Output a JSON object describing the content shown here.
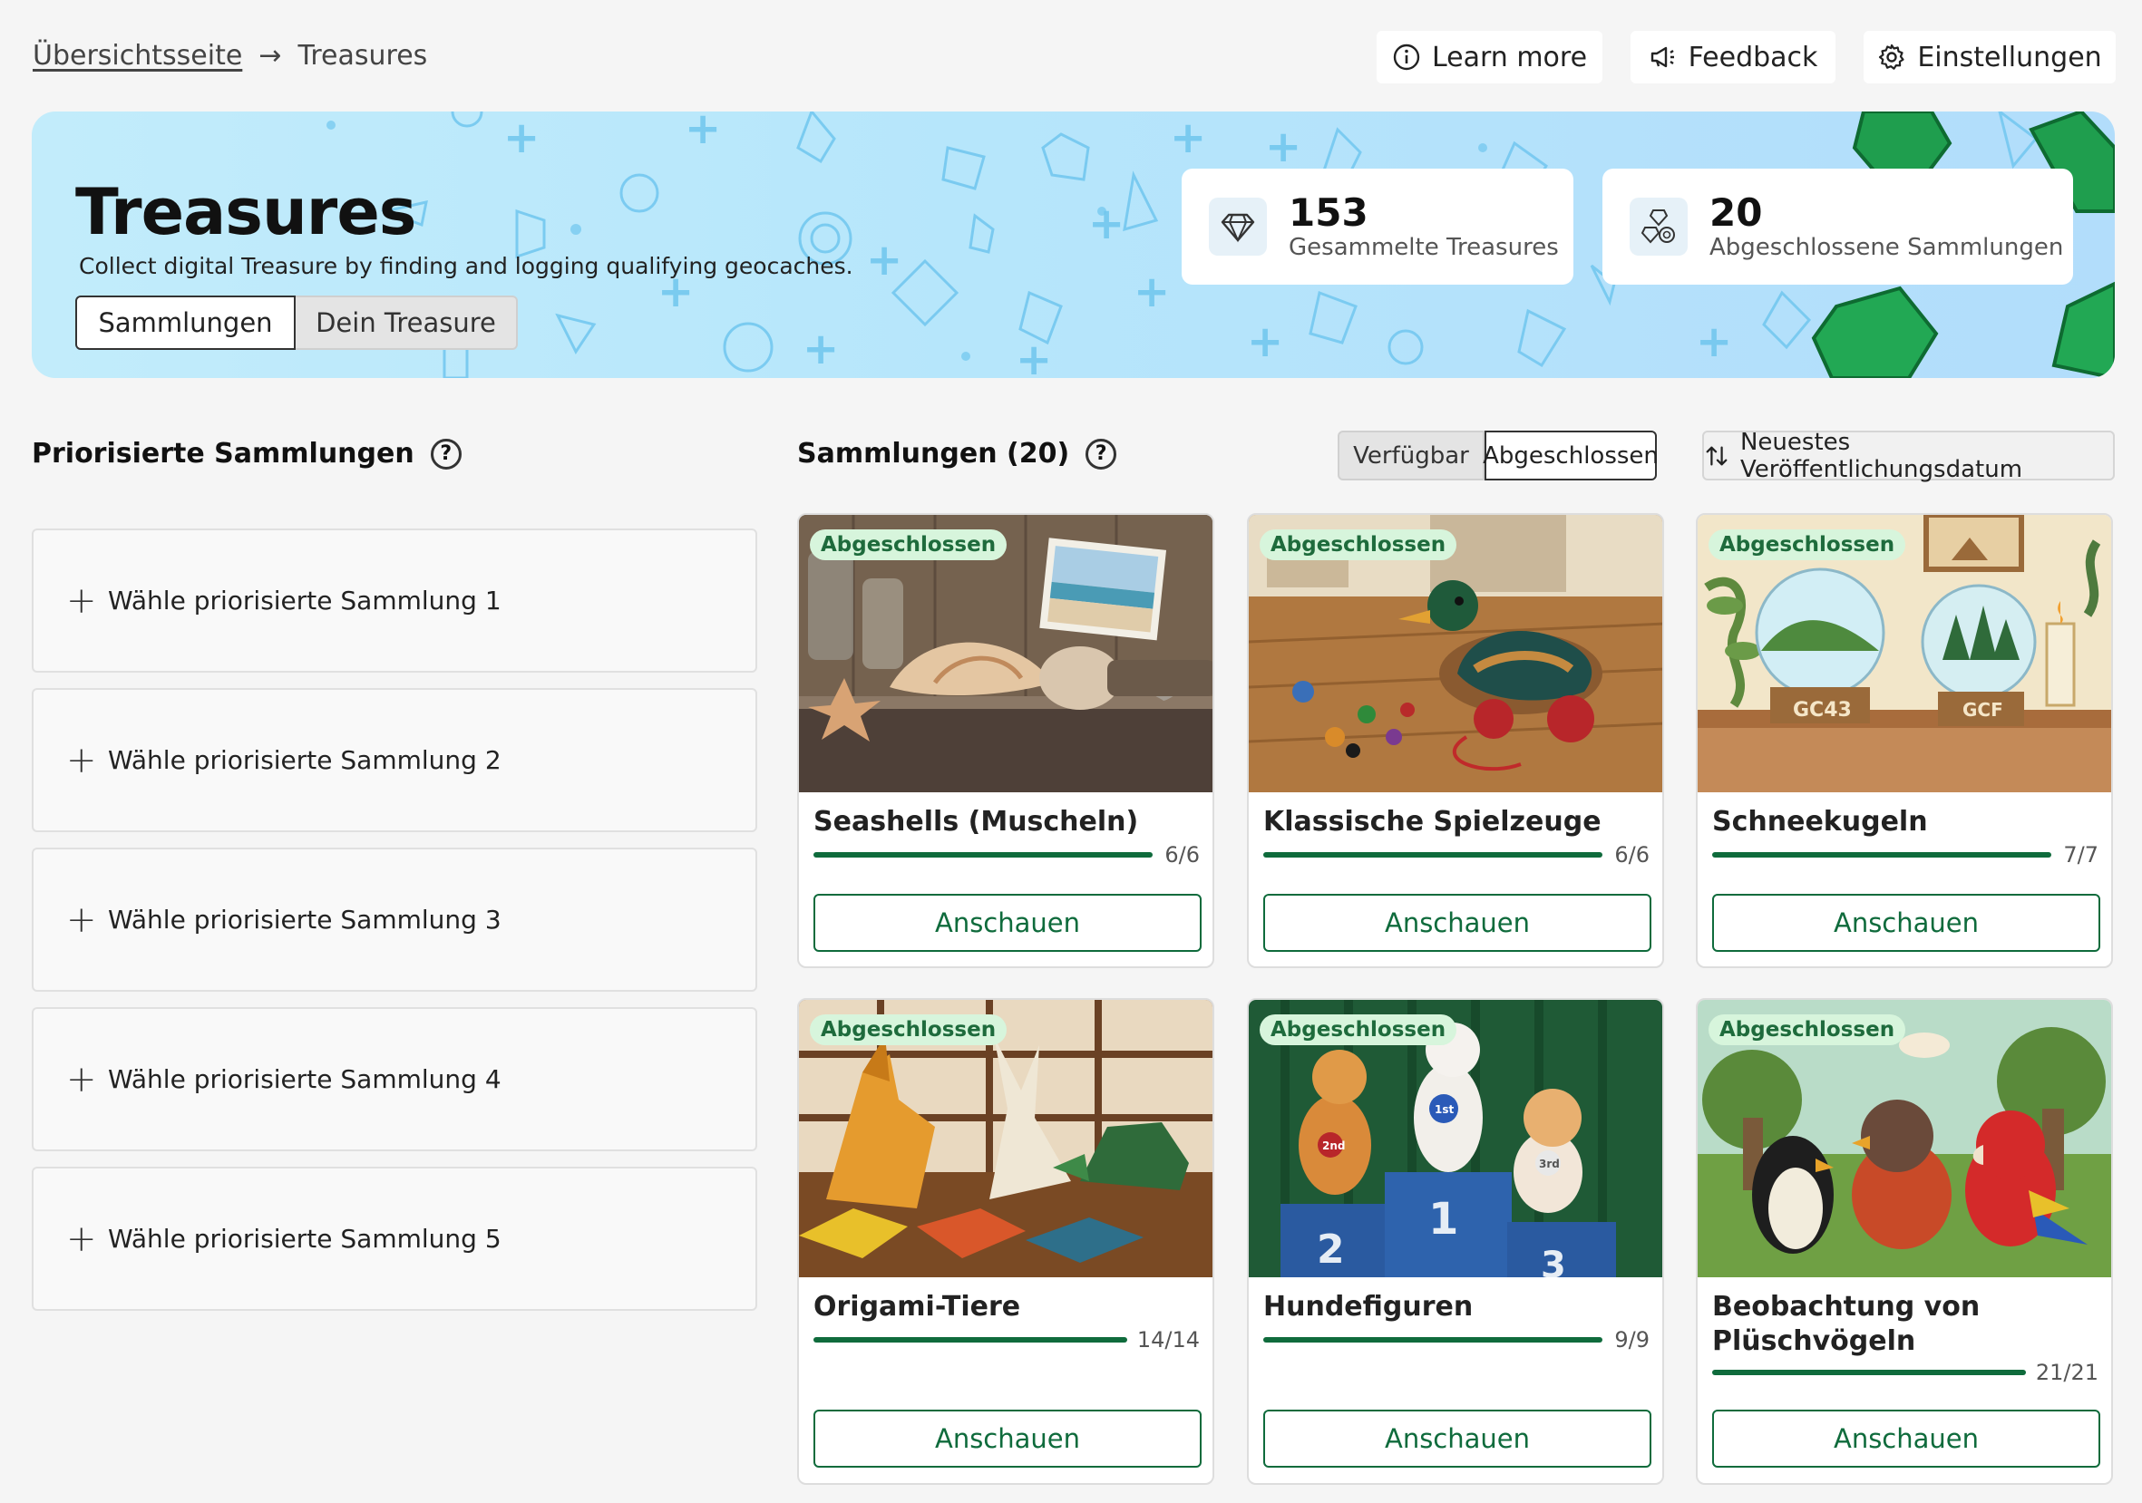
{
  "breadcrumb": {
    "home": "Übersichtsseite",
    "separator": "→",
    "current": "Treasures"
  },
  "topbar": {
    "learn_more": "Learn more",
    "feedback": "Feedback",
    "settings": "Einstellungen"
  },
  "hero": {
    "title": "Treasures",
    "subtitle": "Collect digital Treasure by finding and logging qualifying geocaches.",
    "tabs": [
      {
        "label": "Sammlungen",
        "active": true
      },
      {
        "label": "Dein Treasure",
        "active": false
      }
    ],
    "stats": [
      {
        "value": "153",
        "label": "Gesammelte Treasures",
        "icon": "gem-icon"
      },
      {
        "value": "20",
        "label": "Abgeschlossene Sammlungen",
        "icon": "gems-cluster-icon"
      }
    ]
  },
  "priority": {
    "title": "Priorisierte Sammlungen",
    "slots": [
      "Wähle priorisierte Sammlung 1",
      "Wähle priorisierte Sammlung 2",
      "Wähle priorisierte Sammlung 3",
      "Wähle priorisierte Sammlung 4",
      "Wähle priorisierte Sammlung 5"
    ]
  },
  "collections": {
    "title": "Sammlungen (20)",
    "filters": [
      {
        "label": "Verfügbar",
        "active": false
      },
      {
        "label": "Abgeschlossen",
        "active": true
      }
    ],
    "sort_label": "Neuestes Veröffentlichungsdatum",
    "view_label": "Anschauen",
    "badge_label": "Abgeschlossen",
    "cards": [
      {
        "name": "Seashells (Muscheln)",
        "count": "6/6",
        "progress": 1.0
      },
      {
        "name": "Klassische Spielzeuge",
        "count": "6/6",
        "progress": 1.0
      },
      {
        "name": "Schneekugeln",
        "count": "7/7",
        "progress": 1.0,
        "globe_labels": [
          "GC43",
          "GCF"
        ]
      },
      {
        "name": "Origami-Tiere",
        "count": "14/14",
        "progress": 1.0
      },
      {
        "name": "Hundefiguren",
        "count": "9/9",
        "progress": 1.0,
        "podium_labels": [
          "2",
          "1",
          "3"
        ],
        "ribbon_labels": [
          "2nd",
          "1st",
          "3rd"
        ]
      },
      {
        "name": "Beobachtung von Plüschvögeln",
        "count": "21/21",
        "progress": 1.0
      }
    ]
  },
  "colors": {
    "accent": "#0f6b3c",
    "badge_bg": "#d7f5dc",
    "hero_bg": "#b8e6fb"
  }
}
